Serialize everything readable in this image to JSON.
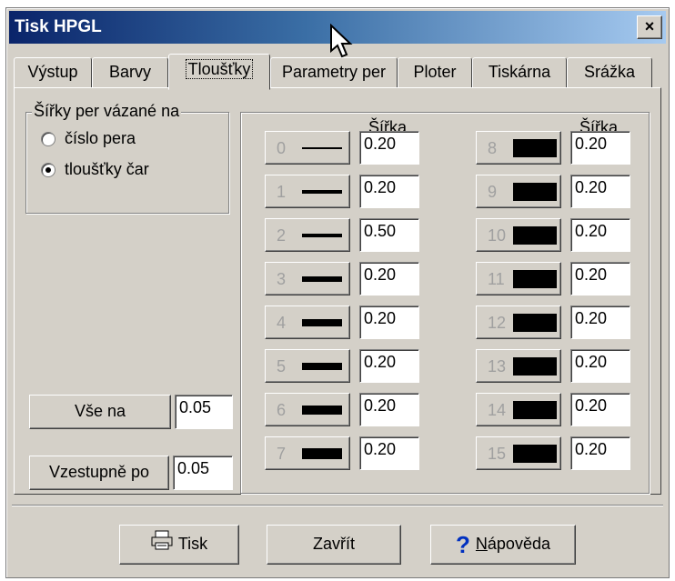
{
  "window": {
    "title": "Tisk HPGL",
    "close_label": "×"
  },
  "tabs": [
    {
      "label": "Výstup"
    },
    {
      "label": "Barvy"
    },
    {
      "label": "Tloušťky"
    },
    {
      "label": "Parametry per"
    },
    {
      "label": "Ploter"
    },
    {
      "label": "Tiskárna"
    },
    {
      "label": "Srážka"
    }
  ],
  "active_tab": "Tloušťky",
  "group": {
    "legend": "Šířky per vázané na",
    "options": [
      {
        "label": "číslo pera",
        "selected": false
      },
      {
        "label": "tloušťky čar",
        "selected": true
      }
    ]
  },
  "vse_na": {
    "label": "Vše na",
    "value": "0.05"
  },
  "vzestupne": {
    "label": "Vzestupně po",
    "value": "0.05"
  },
  "pens": {
    "header": "Šířka",
    "left": [
      {
        "num": "0",
        "width": "0.20"
      },
      {
        "num": "1",
        "width": "0.20"
      },
      {
        "num": "2",
        "width": "0.50"
      },
      {
        "num": "3",
        "width": "0.20"
      },
      {
        "num": "4",
        "width": "0.20"
      },
      {
        "num": "5",
        "width": "0.20"
      },
      {
        "num": "6",
        "width": "0.20"
      },
      {
        "num": "7",
        "width": "0.20"
      }
    ],
    "right": [
      {
        "num": "8",
        "width": "0.20"
      },
      {
        "num": "9",
        "width": "0.20"
      },
      {
        "num": "10",
        "width": "0.20"
      },
      {
        "num": "11",
        "width": "0.20"
      },
      {
        "num": "12",
        "width": "0.20"
      },
      {
        "num": "13",
        "width": "0.20"
      },
      {
        "num": "14",
        "width": "0.20"
      },
      {
        "num": "15",
        "width": "0.20"
      }
    ]
  },
  "footer": {
    "print_label": "Tisk",
    "close_label": "Zavřít",
    "help_label": "Nápověda",
    "help_access_key": "N",
    "help_rest": "ápověda"
  },
  "icons": {
    "print": "printer-icon",
    "help": "question-mark-icon",
    "cursor": "mouse-pointer-icon"
  }
}
